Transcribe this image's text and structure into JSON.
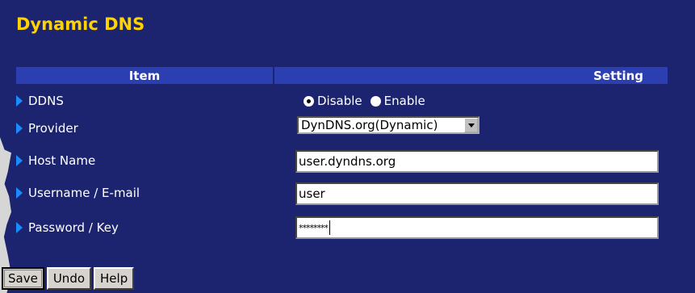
{
  "page": {
    "title": "Dynamic DNS"
  },
  "table": {
    "header_item": "Item",
    "header_setting": "Setting"
  },
  "rows": {
    "ddns": {
      "label": "DDNS",
      "options": [
        "Disable",
        "Enable"
      ],
      "selected": "Disable"
    },
    "provider": {
      "label": "Provider",
      "selected_value": "DynDNS.org(Dynamic)"
    },
    "host_name": {
      "label": "Host Name",
      "value": "user.dyndns.org"
    },
    "username": {
      "label": "Username / E-mail",
      "value": "user"
    },
    "password": {
      "label": "Password / Key",
      "value": "********"
    }
  },
  "buttons": {
    "save": "Save",
    "undo": "Undo",
    "help": "Help"
  },
  "colors": {
    "background": "#1c246f",
    "title": "#ffd200",
    "header": "#2c3fb0",
    "arrow": "#1a8cff"
  }
}
